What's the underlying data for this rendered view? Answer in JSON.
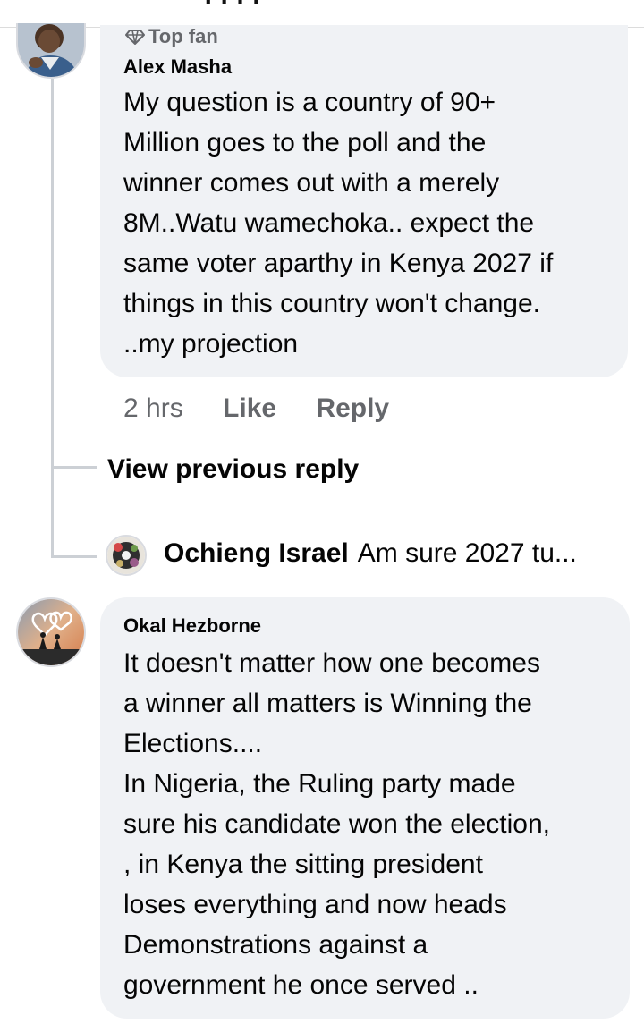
{
  "comments": [
    {
      "badge": "Top fan",
      "author": "Alex Masha",
      "lines": [
        "My question is a country of 90+",
        "Million goes to the poll and the",
        "winner comes out with a merely",
        "8M..Watu wamechoka.. expect the",
        "same voter aparthy in Kenya 2027 if",
        "things in this country won't change.",
        "..my projection"
      ],
      "time": "2 hrs",
      "like_label": "Like",
      "reply_label": "Reply",
      "view_previous_label": "View previous reply",
      "reply_preview": {
        "author": "Ochieng Israel",
        "text": "Am sure 2027 tu..."
      }
    },
    {
      "author": "Okal Hezborne",
      "lines": [
        "It doesn't matter how one becomes",
        "a winner all matters is Winning the",
        "Elections....",
        "In Nigeria, the Ruling party made",
        "sure his candidate won the election,",
        ", in Kenya the sitting president",
        "loses everything and now heads",
        "Demonstrations against a",
        "government he once served .."
      ]
    }
  ]
}
